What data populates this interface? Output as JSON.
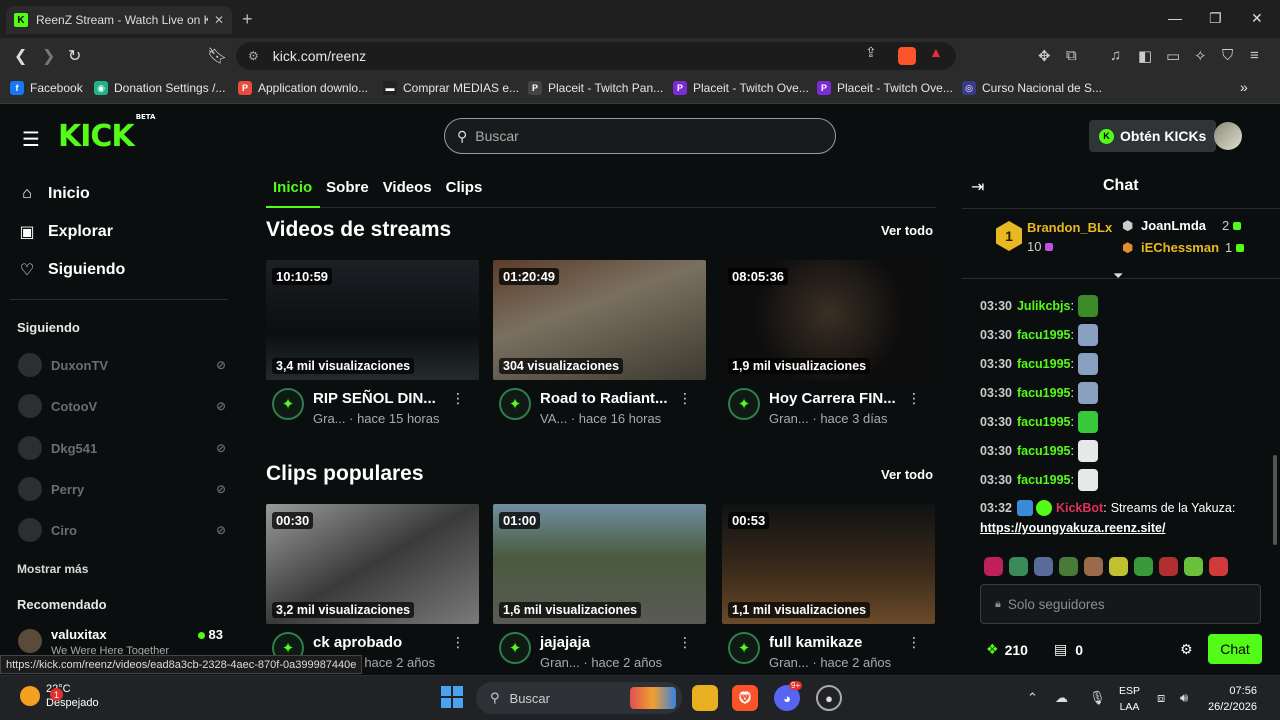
{
  "browser": {
    "tab_title": "ReenZ Stream - Watch Live on Ki",
    "tab_close": "✕",
    "new_tab": "+",
    "url": "kick.com/reenz",
    "bookmarks": [
      {
        "label": "Facebook",
        "color": "#1877f2",
        "glyph": "f"
      },
      {
        "label": "Donation Settings /...",
        "color": "#1fb38a",
        "glyph": "◉"
      },
      {
        "label": "Application downlo...",
        "color": "#e84c3d",
        "glyph": "P"
      },
      {
        "label": "Comprar MEDIAS e...",
        "color": "#222222",
        "glyph": "▬"
      },
      {
        "label": "Placeit - Twitch Pan...",
        "color": "#444444",
        "glyph": "P"
      },
      {
        "label": "Placeit - Twitch Ove...",
        "color": "#7b2cd6",
        "glyph": "P"
      },
      {
        "label": "Placeit - Twitch Ove...",
        "color": "#7b2cd6",
        "glyph": "P"
      },
      {
        "label": "Curso Nacional de S...",
        "color": "#3a3a8a",
        "glyph": "◎"
      }
    ],
    "bookmarks_more": "»",
    "status_url": "https://kick.com/reenz/videos/ead8a3cb-2328-4aec-870f-0a399987440e"
  },
  "header": {
    "logo": "KICK",
    "logo_badge": "BETA",
    "search_placeholder": "Buscar",
    "kicks_button": "Obtén KICKs"
  },
  "sidebar": {
    "nav": [
      {
        "label": "Inicio",
        "icon": "⌂"
      },
      {
        "label": "Explorar",
        "icon": "▣"
      },
      {
        "label": "Siguiendo",
        "icon": "♡"
      }
    ],
    "following_title": "Siguiendo",
    "following": [
      "DuxonTV",
      "CotooV",
      "Dkg541",
      "Perry",
      "Ciro"
    ],
    "show_more": "Mostrar más",
    "recommended_title": "Recomendado",
    "recommended": {
      "name": "valuxitax",
      "subtitle": "We Were Here Together",
      "viewers": "83"
    }
  },
  "main": {
    "tabs": [
      "Inicio",
      "Sobre",
      "Videos",
      "Clips"
    ],
    "streams_title": "Videos de streams",
    "clips_title": "Clips populares",
    "see_all": "Ver todo",
    "videos": [
      {
        "duration": "10:10:59",
        "views": "3,4 mil visualizaciones",
        "title": "RIP SEÑOL DIN...",
        "channel": "Gra...",
        "age": "· hace 15 horas"
      },
      {
        "duration": "01:20:49",
        "views": "304 visualizaciones",
        "title": "Road to Radiant...",
        "channel": "VA...",
        "age": "· hace 16 horas"
      },
      {
        "duration": "08:05:36",
        "views": "1,9 mil visualizaciones",
        "title": "Hoy Carrera FIN...",
        "channel": "Gran...",
        "age": "· hace 3 días"
      }
    ],
    "clips": [
      {
        "duration": "00:30",
        "views": "3,2 mil visualizaciones",
        "title": "ck aprobado",
        "channel": "Gran...",
        "age": "· hace 2 años"
      },
      {
        "duration": "01:00",
        "views": "1,6 mil visualizaciones",
        "title": "jajajaja",
        "channel": "Gran...",
        "age": "· hace 2 años"
      },
      {
        "duration": "00:53",
        "views": "1,1 mil visualizaciones",
        "title": "full kamikaze",
        "channel": "Gran...",
        "age": "· hace 2 años"
      }
    ]
  },
  "chat": {
    "title": "Chat",
    "leaderboard": [
      {
        "rank": "1",
        "name": "Brandon_BLx",
        "value": "10",
        "color": "#e8b923"
      },
      {
        "rank": "2",
        "name": "JoanLmda",
        "value": "2",
        "color": "#ffffff"
      },
      {
        "rank": "3",
        "name": "iEChessman",
        "value": "1",
        "color": "#e8b923"
      }
    ],
    "messages": [
      {
        "time": "03:30",
        "user": "Julikcbjs",
        "emote": "#3a8a2a"
      },
      {
        "time": "03:30",
        "user": "facu1995",
        "emote": "#8aa0c0"
      },
      {
        "time": "03:30",
        "user": "facu1995",
        "emote": "#8aa0c0"
      },
      {
        "time": "03:30",
        "user": "facu1995",
        "emote": "#8aa0c0"
      },
      {
        "time": "03:30",
        "user": "facu1995",
        "emote": "#39c83a"
      },
      {
        "time": "03:30",
        "user": "facu1995",
        "emote": "#e8e8e8"
      },
      {
        "time": "03:30",
        "user": "facu1995",
        "emote": "#e8e8e8"
      }
    ],
    "bot_message": {
      "time": "03:32",
      "user": "KickBot",
      "text": "Streams de la Yakuza:",
      "link": "https://youngyakuza.reenz.site/"
    },
    "input_placeholder": "Solo seguidores",
    "points": "210",
    "gifts": "0",
    "send": "Chat"
  },
  "taskbar": {
    "temp": "22°C",
    "weather": "Despejado",
    "weather_badge": "1",
    "search": "Buscar",
    "lang1": "ESP",
    "lang2": "LAA",
    "time": "07:56",
    "date": "26/2/2026",
    "discord_badge": "9+"
  }
}
